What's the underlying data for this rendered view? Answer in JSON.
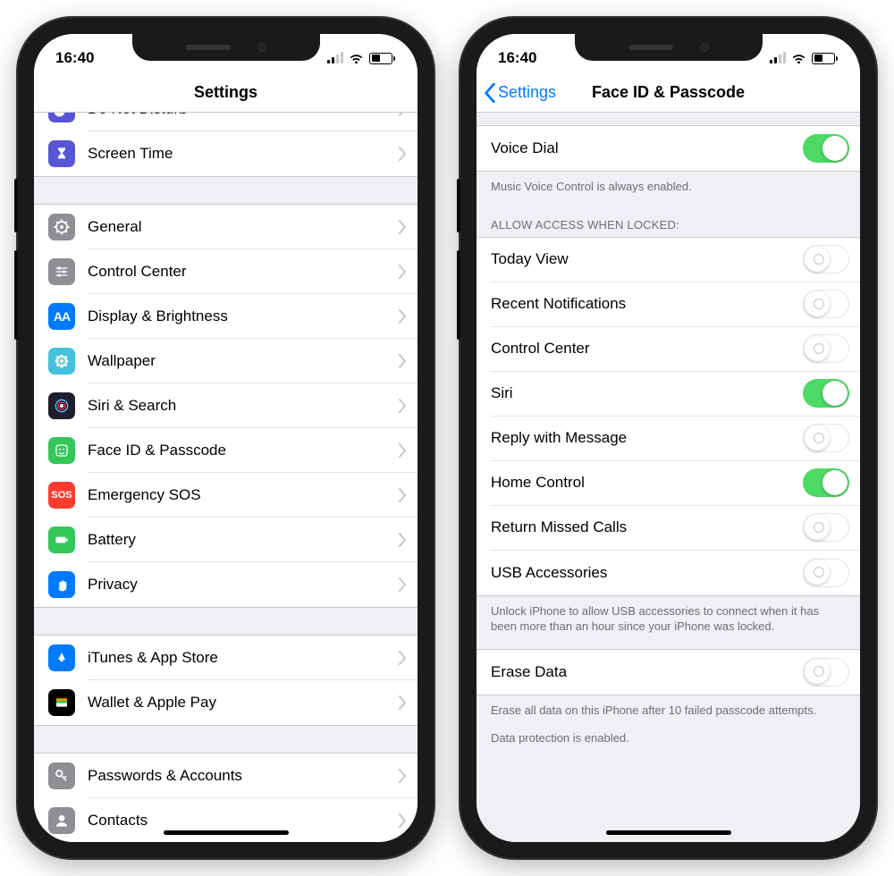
{
  "status": {
    "time": "16:40"
  },
  "left": {
    "title": "Settings",
    "group1": [
      {
        "label": "Do Not Disturb",
        "bg": "#5856d6",
        "icon": "moon"
      },
      {
        "label": "Screen Time",
        "bg": "#5856d6",
        "icon": "hourglass"
      }
    ],
    "group2": [
      {
        "label": "General",
        "bg": "#8e8e93",
        "icon": "gear"
      },
      {
        "label": "Control Center",
        "bg": "#8e8e93",
        "icon": "sliders"
      },
      {
        "label": "Display & Brightness",
        "bg": "#007aff",
        "icon": "aa"
      },
      {
        "label": "Wallpaper",
        "bg": "#45c1de",
        "icon": "flower"
      },
      {
        "label": "Siri & Search",
        "bg": "#1e1e2e",
        "icon": "siri"
      },
      {
        "label": "Face ID & Passcode",
        "bg": "#34c759",
        "icon": "face"
      },
      {
        "label": "Emergency SOS",
        "bg": "#ff3b30",
        "icon": "sos"
      },
      {
        "label": "Battery",
        "bg": "#34c759",
        "icon": "battery"
      },
      {
        "label": "Privacy",
        "bg": "#007aff",
        "icon": "hand"
      }
    ],
    "group3": [
      {
        "label": "iTunes & App Store",
        "bg": "#007aff",
        "icon": "appstore"
      },
      {
        "label": "Wallet & Apple Pay",
        "bg": "#000000",
        "icon": "wallet"
      }
    ],
    "group4": [
      {
        "label": "Passwords & Accounts",
        "bg": "#8e8e93",
        "icon": "key"
      },
      {
        "label": "Contacts",
        "bg": "#8e8e93",
        "icon": "contacts"
      }
    ]
  },
  "right": {
    "back": "Settings",
    "title": "Face ID & Passcode",
    "voice_dial": {
      "label": "Voice Dial",
      "on": true
    },
    "voice_footer": "Music Voice Control is always enabled.",
    "allow_header": "ALLOW ACCESS WHEN LOCKED:",
    "allow": [
      {
        "label": "Today View",
        "on": false
      },
      {
        "label": "Recent Notifications",
        "on": false
      },
      {
        "label": "Control Center",
        "on": false
      },
      {
        "label": "Siri",
        "on": true
      },
      {
        "label": "Reply with Message",
        "on": false
      },
      {
        "label": "Home Control",
        "on": true
      },
      {
        "label": "Return Missed Calls",
        "on": false
      },
      {
        "label": "USB Accessories",
        "on": false
      }
    ],
    "usb_footer": "Unlock iPhone to allow USB accessories to connect when it has been more than an hour since your iPhone was locked.",
    "erase": {
      "label": "Erase Data",
      "on": false
    },
    "erase_footer1": "Erase all data on this iPhone after 10 failed passcode attempts.",
    "erase_footer2": "Data protection is enabled."
  }
}
